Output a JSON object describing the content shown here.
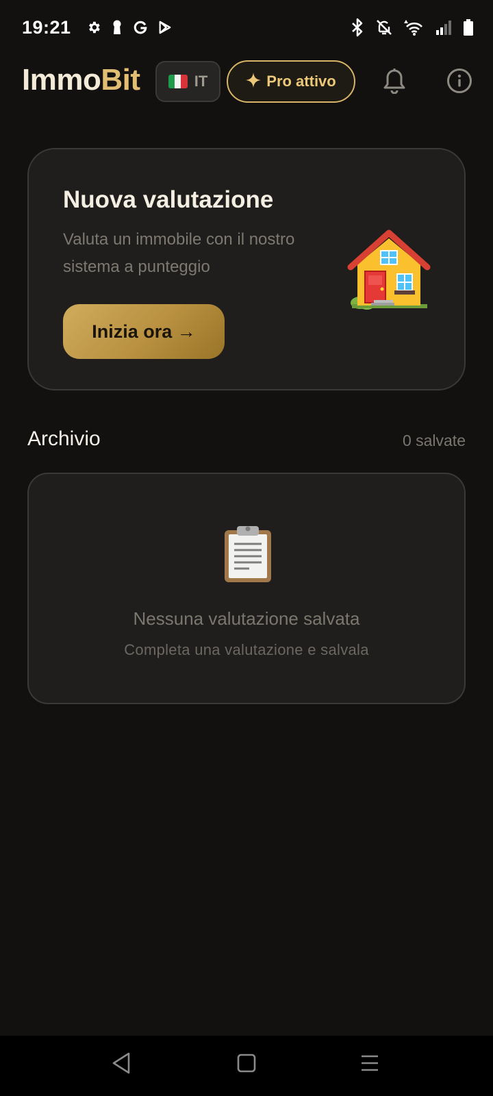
{
  "status_bar": {
    "time": "19:21",
    "left_icons": [
      "settings-icon",
      "keyhole-icon",
      "google-icon",
      "play-store-icon"
    ],
    "right_icons": [
      "bluetooth-icon",
      "bell-off-icon",
      "wifi-icon",
      "signal-icon",
      "battery-icon"
    ]
  },
  "header": {
    "brand_part1": "Immo",
    "brand_part2": "Bit",
    "language": {
      "label": "IT",
      "flag_icon": "italy-flag-icon"
    },
    "pro": {
      "label": "Pro attivo",
      "icon": "sparkle-icon"
    },
    "notifications_icon": "bell-icon",
    "info_icon": "info-icon"
  },
  "new_valuation": {
    "title": "Nuova valutazione",
    "description": "Valuta un immobile con il nostro sistema a punteggio",
    "button_label": "Inizia ora →",
    "illustration": "house-icon"
  },
  "archive": {
    "title": "Archivio",
    "count_label": "0 salvate",
    "empty_icon": "clipboard-icon",
    "empty_title": "Nessuna valutazione salvata",
    "empty_subtitle": "Completa una valutazione e salvala"
  },
  "nav": {
    "back_icon": "back-icon",
    "home_icon": "home-icon",
    "menu_icon": "menu-icon"
  },
  "colors": {
    "background": "#121110",
    "card": "#1f1e1c",
    "accent_gold": "#e2be72",
    "button_gradient_start": "#cfac5c",
    "button_gradient_end": "#9a7428"
  }
}
